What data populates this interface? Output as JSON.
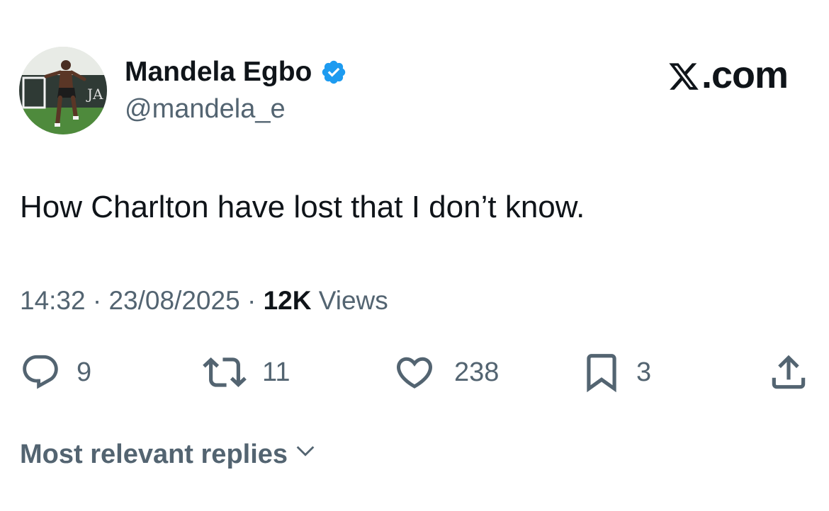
{
  "author": {
    "display_name": "Mandela Egbo",
    "handle": "@mandela_e"
  },
  "brand": {
    "text": ".com",
    "logo_icon": "x-logo-icon"
  },
  "tweet": {
    "text": "How Charlton have lost that I don’t know.",
    "time": "14:32",
    "date": "23/08/2025",
    "views_count": "12K",
    "views_label": "Views"
  },
  "actions": {
    "replies": "9",
    "reposts": "11",
    "likes": "238",
    "bookmarks": "3"
  },
  "replies_sort": {
    "label": "Most relevant replies"
  },
  "colors": {
    "text_primary": "#0f1419",
    "text_secondary": "#536471",
    "verified_blue": "#1d9bf0"
  }
}
